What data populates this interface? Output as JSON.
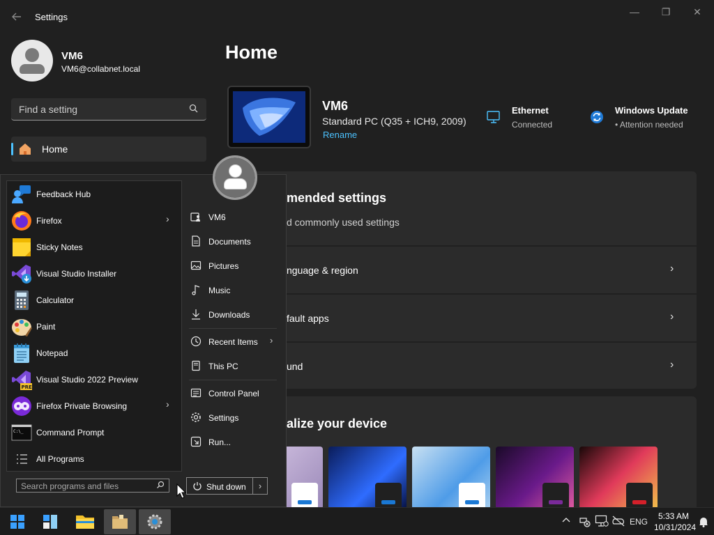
{
  "window": {
    "title": "Settings",
    "controls": {
      "minimize": "—",
      "maximize": "❐",
      "close": "✕"
    }
  },
  "profile": {
    "name": "VM6",
    "email": "VM6@collabnet.local"
  },
  "search": {
    "placeholder": "Find a setting"
  },
  "nav": {
    "home_label": "Home"
  },
  "home": {
    "title": "Home",
    "device": {
      "name": "VM6",
      "spec": "Standard PC (Q35 + ICH9, 2009)",
      "rename": "Rename"
    },
    "ethernet": {
      "title": "Ethernet",
      "status": "Connected"
    },
    "windows_update": {
      "title": "Windows Update",
      "status": "• Attention needed"
    },
    "recommended": {
      "title": "mended settings",
      "subtitle": "d commonly used settings",
      "rows": [
        "nguage & region",
        "fault apps",
        "und"
      ]
    },
    "personalize": {
      "title": "alize your device"
    }
  },
  "start_menu": {
    "programs": [
      {
        "label": "Feedback Hub",
        "icon": "feedback-hub-icon",
        "has_submenu": false
      },
      {
        "label": "Firefox",
        "icon": "firefox-icon",
        "has_submenu": true
      },
      {
        "label": "Sticky Notes",
        "icon": "sticky-notes-icon",
        "has_submenu": false
      },
      {
        "label": "Visual Studio Installer",
        "icon": "vs-installer-icon",
        "has_submenu": false
      },
      {
        "label": "Calculator",
        "icon": "calculator-icon",
        "has_submenu": false
      },
      {
        "label": "Paint",
        "icon": "paint-icon",
        "has_submenu": false
      },
      {
        "label": "Notepad",
        "icon": "notepad-icon",
        "has_submenu": false
      },
      {
        "label": "Visual Studio 2022 Preview",
        "icon": "vs-preview-icon",
        "has_submenu": false
      },
      {
        "label": "Firefox Private Browsing",
        "icon": "firefox-private-icon",
        "has_submenu": true
      },
      {
        "label": "Command Prompt",
        "icon": "command-prompt-icon",
        "has_submenu": false
      },
      {
        "label": "All Programs",
        "icon": "all-programs-icon",
        "has_submenu": false
      }
    ],
    "search_placeholder": "Search programs and files",
    "pre_badge": "PRE",
    "cmd_text": "C:\\_",
    "places": [
      {
        "label": "VM6",
        "icon": "user-folder-icon"
      },
      {
        "label": "Documents",
        "icon": "documents-icon"
      },
      {
        "label": "Pictures",
        "icon": "pictures-icon"
      },
      {
        "label": "Music",
        "icon": "music-icon"
      },
      {
        "label": "Downloads",
        "icon": "downloads-icon"
      },
      {
        "label": "Recent Items",
        "icon": "recent-items-icon",
        "has_submenu": true
      },
      {
        "label": "This PC",
        "icon": "this-pc-icon"
      },
      {
        "label": "Control Panel",
        "icon": "control-panel-icon"
      },
      {
        "label": "Settings",
        "icon": "settings-gear-icon"
      },
      {
        "label": "Run...",
        "icon": "run-icon"
      }
    ],
    "shutdown_label": "Shut down"
  },
  "taskbar": {
    "language": "ENG",
    "time": "5:33 AM",
    "date": "10/31/2024"
  },
  "colors": {
    "accent": "#4cc2ff",
    "background": "#202020",
    "card": "#2b2b2b",
    "taskbar": "#1c1c1c"
  }
}
